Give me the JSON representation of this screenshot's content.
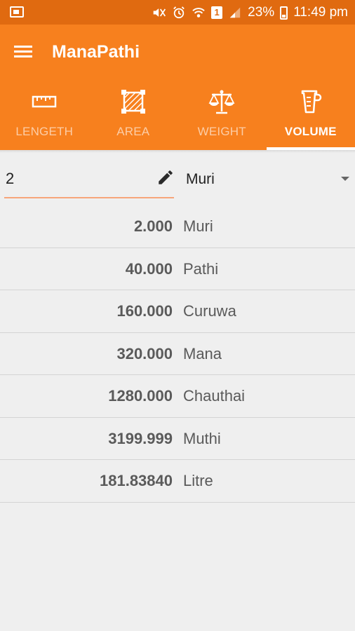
{
  "status_bar": {
    "battery": "23%",
    "time": "11:49 pm",
    "sim_label": "1"
  },
  "app": {
    "title": "ManaPathi",
    "accent_color": "#f7801e",
    "status_color": "#e06a10"
  },
  "tabs": [
    {
      "label": "LENGETH",
      "icon": "ruler-icon",
      "active": false
    },
    {
      "label": "AREA",
      "icon": "area-icon",
      "active": false
    },
    {
      "label": "WEIGHT",
      "icon": "scale-icon",
      "active": false
    },
    {
      "label": "VOLUME",
      "icon": "beaker-icon",
      "active": true
    }
  ],
  "converter": {
    "input_value": "2",
    "selected_unit": "Muri"
  },
  "results": [
    {
      "value": "2.000",
      "unit": "Muri"
    },
    {
      "value": "40.000",
      "unit": "Pathi"
    },
    {
      "value": "160.000",
      "unit": "Curuwa"
    },
    {
      "value": "320.000",
      "unit": "Mana"
    },
    {
      "value": "1280.000",
      "unit": "Chauthai"
    },
    {
      "value": "3199.999",
      "unit": "Muthi"
    },
    {
      "value": "181.83840",
      "unit": "Litre"
    }
  ]
}
